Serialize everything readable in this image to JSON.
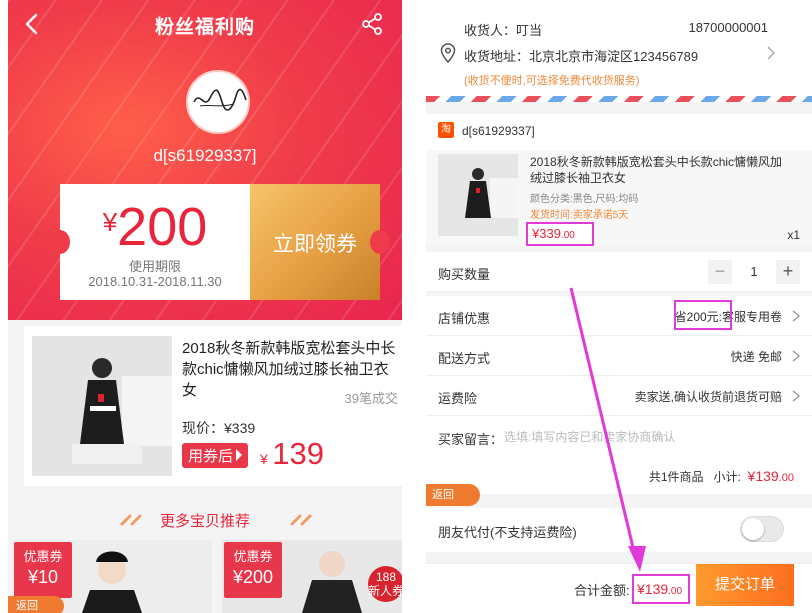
{
  "left": {
    "nav_title": "粉丝福利购",
    "shop_name": "d[s61929337]",
    "avatar_signature": "signature logo",
    "coupon": {
      "currency": "¥",
      "amount": "200",
      "validity_label": "使用期限",
      "dates": "2018.10.31-2018.11.30",
      "claim_label": "立即领券"
    },
    "product": {
      "title": "2018秋冬新款韩版宽松套头中长款chic慵懒风加绒过膝长袖卫衣女",
      "sold": "39笔成交",
      "current_price": "现价：¥339",
      "after_coupon_label": "用券后",
      "after_price_currency": "¥",
      "after_price": "139"
    },
    "more_title": "更多宝贝推荐",
    "recommendations": [
      {
        "badge_title": "优惠券",
        "badge_value": "¥10"
      },
      {
        "badge_title": "优惠券",
        "badge_value": "¥200"
      }
    ],
    "round_badge": {
      "num": "188",
      "text": "新人券"
    },
    "back_label": "返回"
  },
  "right": {
    "receiver": "收货人：叮当",
    "phone": "18700000001",
    "address": "收货地址：北京北京市海淀区123456789",
    "address_note": "(收货不便时,可选择免费代收货服务)",
    "shop_logo": "淘",
    "shop_name": "d[s61929337]",
    "item": {
      "title": "2018秋冬新款韩版宽松套头中长款chic慵懒风加绒过膝长袖卫衣女",
      "spec": "颜色分类:黑色,尺码:均码",
      "shipping": "发货时间:卖家承诺5天",
      "price_main": "¥339",
      "price_cents": ".00",
      "qty": "x1"
    },
    "rows": {
      "quantity_label": "购买数量",
      "quantity_value": "1",
      "minus": "−",
      "plus": "+",
      "discount_label": "店铺优惠",
      "discount_value": "省200元:客服专用卷",
      "delivery_label": "配送方式",
      "delivery_value": "快递 免邮",
      "insurance_label": "运费险",
      "insurance_value": "卖家送,确认收货前退货可赔"
    },
    "message": {
      "label": "买家留言：",
      "placeholder": "选填:填写内容已和卖家协商确认"
    },
    "subtotal": {
      "count_text": "共1件商品",
      "label": "小计:",
      "price_main": "¥139",
      "price_cents": ".00"
    },
    "back_label": "返回",
    "friend_pay_label": "朋友代付(不支持运费险)",
    "friend_pay_enabled": false,
    "total_label": "合计金额:",
    "total_main": "¥139",
    "total_cents": ".00",
    "submit_label": "提交订单"
  },
  "colors": {
    "brand_red": "#e8253b",
    "highlight_magenta": "#e23ad8",
    "submit_orange": "#ff7a25",
    "gold": "#e9a247"
  }
}
